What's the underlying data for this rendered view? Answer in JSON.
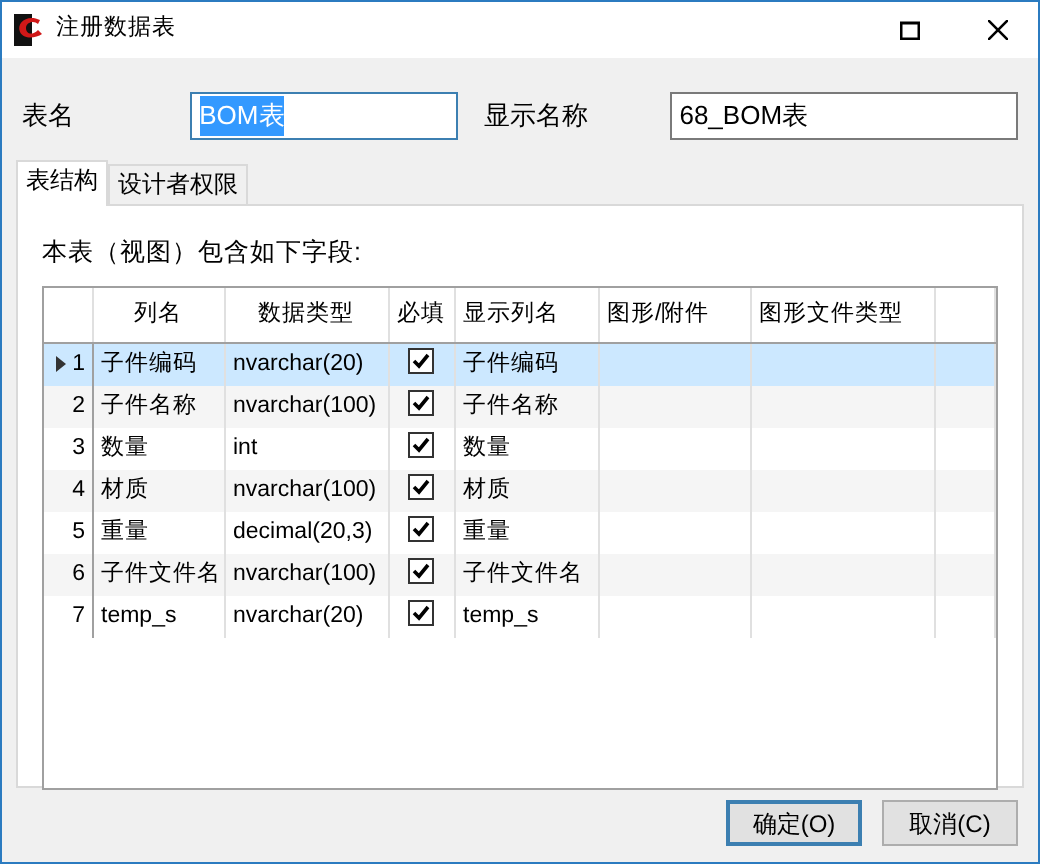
{
  "window": {
    "title": "注册数据表"
  },
  "form": {
    "table_name_label": "表名",
    "table_name_value": "BOM表",
    "display_name_label": "显示名称",
    "display_name_value": "68_BOM表"
  },
  "tabs": [
    {
      "label": "表结构",
      "selected": true
    },
    {
      "label": "设计者权限",
      "selected": false
    }
  ],
  "caption": "本表（视图）包含如下字段:",
  "table": {
    "columns": [
      "列名",
      "数据类型",
      "必填",
      "显示列名",
      "图形/附件",
      "图形文件类型"
    ],
    "rows": [
      {
        "index": "1",
        "name": "子件编码",
        "type": "nvarchar(20)",
        "required": true,
        "display": "子件编码",
        "selected": true
      },
      {
        "index": "2",
        "name": "子件名称",
        "type": "nvarchar(100)",
        "required": true,
        "display": "子件名称",
        "selected": false
      },
      {
        "index": "3",
        "name": "数量",
        "type": "int",
        "required": true,
        "display": "数量",
        "selected": false
      },
      {
        "index": "4",
        "name": "材质",
        "type": "nvarchar(100)",
        "required": true,
        "display": "材质",
        "selected": false
      },
      {
        "index": "5",
        "name": "重量",
        "type": "decimal(20,3)",
        "required": true,
        "display": "重量",
        "selected": false
      },
      {
        "index": "6",
        "name": "子件文件名",
        "type": "nvarchar(100)",
        "required": true,
        "display": "子件文件名",
        "selected": false
      },
      {
        "index": "7",
        "name": "temp_s",
        "type": "nvarchar(20)",
        "required": true,
        "display": "temp_s",
        "selected": false
      }
    ]
  },
  "buttons": [
    "确定(O)",
    "取消(C)"
  ]
}
